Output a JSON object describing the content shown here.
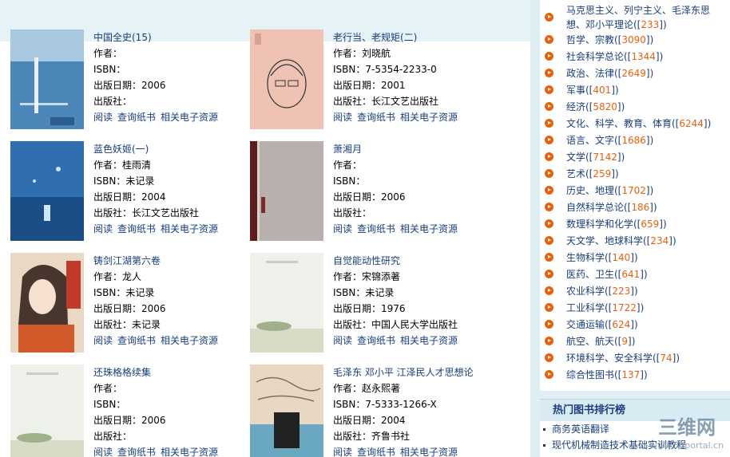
{
  "labels": {
    "author": "作者：",
    "isbn": "ISBN：",
    "date": "出版日期：",
    "publisher": "出版社：",
    "read": "阅读",
    "query": "查询纸书",
    "related": "相关电子资源"
  },
  "books": [
    {
      "title": "中国全史(15)",
      "author": "",
      "isbn": "",
      "date": "2006",
      "publisher": ""
    },
    {
      "title": "老行当、老规矩(二)",
      "author": "刘晓航",
      "isbn": "7-5354-2233-0",
      "date": "2001",
      "publisher": "长江文艺出版社"
    },
    {
      "title": "蓝色妖姬(一)",
      "author": "桂雨清",
      "isbn": "未记录",
      "date": "2004",
      "publisher": "长江文艺出版社"
    },
    {
      "title": "萧湘月",
      "author": "",
      "isbn": "",
      "date": "2006",
      "publisher": ""
    },
    {
      "title": "铸剑江湖第六卷",
      "author": "龙人",
      "isbn": "未记录",
      "date": "2006",
      "publisher": "未记录"
    },
    {
      "title": "自觉能动性研究",
      "author": "宋锦添著",
      "isbn": "未记录",
      "date": "1976",
      "publisher": "中国人民大学出版社"
    },
    {
      "title": "还珠格格续集",
      "author": "",
      "isbn": "",
      "date": "2006",
      "publisher": ""
    },
    {
      "title": "毛泽东 邓小平 江泽民人才思想论",
      "author": "赵永熙著",
      "isbn": "7-5333-1266-X",
      "date": "2004",
      "publisher": "齐鲁书社"
    }
  ],
  "categories": [
    {
      "name": "马克思主义、列宁主义、毛泽东思",
      "name2": "想、邓小平理论",
      "count": "233"
    },
    {
      "name": "哲学、宗教",
      "count": "3090"
    },
    {
      "name": "社会科学总论",
      "count": "1344"
    },
    {
      "name": "政治、法律",
      "count": "2649"
    },
    {
      "name": "军事",
      "count": "401"
    },
    {
      "name": "经济",
      "count": "5820"
    },
    {
      "name": "文化、科学、教育、体育",
      "count": "6244"
    },
    {
      "name": "语言、文字",
      "count": "1686"
    },
    {
      "name": "文学",
      "count": "7142"
    },
    {
      "name": "艺术",
      "count": "259"
    },
    {
      "name": "历史、地理",
      "count": "1702"
    },
    {
      "name": "自然科学总论",
      "count": "186"
    },
    {
      "name": "数理科学和化学",
      "count": "659"
    },
    {
      "name": "天文学、地球科学",
      "count": "234"
    },
    {
      "name": "生物科学",
      "count": "140"
    },
    {
      "name": "医药、卫生",
      "count": "641"
    },
    {
      "name": "农业科学",
      "count": "223"
    },
    {
      "name": "工业科学",
      "count": "1722"
    },
    {
      "name": "交通运输",
      "count": "624"
    },
    {
      "name": "航空、航天",
      "count": "9"
    },
    {
      "name": "环境科学、安全科学",
      "count": "74"
    },
    {
      "name": "综合性图书",
      "count": "137"
    }
  ],
  "hot": {
    "heading": "热门图书排行榜",
    "items": [
      "商务英语翻译",
      "现代机械制造技术基础实训教程"
    ]
  },
  "logo": {
    "text": "三维网",
    "sub": "www.3dportal.cn"
  },
  "colors": {
    "link": "#1a3d7c",
    "count": "#e8620e",
    "sidebar": "#dfeef2",
    "band": "#e6f3f6"
  }
}
